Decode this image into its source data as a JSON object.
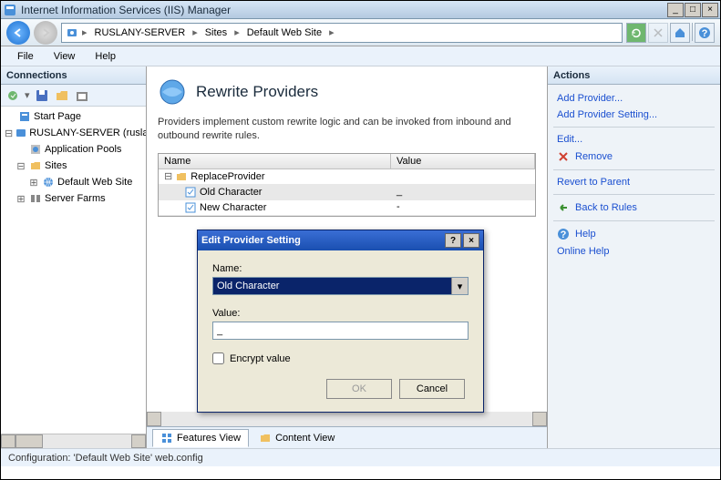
{
  "window": {
    "title": "Internet Information Services (IIS) Manager"
  },
  "breadcrumb": {
    "server": "RUSLANY-SERVER",
    "sites": "Sites",
    "site": "Default Web Site"
  },
  "menus": {
    "file": "File",
    "view": "View",
    "help": "Help"
  },
  "connections": {
    "header": "Connections",
    "start_page": "Start Page",
    "server": "RUSLANY-SERVER (ruslany)",
    "app_pools": "Application Pools",
    "sites": "Sites",
    "default_site": "Default Web Site",
    "server_farms": "Server Farms"
  },
  "page": {
    "title": "Rewrite Providers",
    "description": "Providers implement custom rewrite logic and can be invoked from inbound and outbound rewrite rules.",
    "columns": {
      "name": "Name",
      "value": "Value"
    },
    "rows": [
      {
        "name": "ReplaceProvider",
        "value": "",
        "type": "folder"
      },
      {
        "name": "Old Character",
        "value": "_",
        "type": "setting"
      },
      {
        "name": "New Character",
        "value": "-",
        "type": "setting"
      }
    ]
  },
  "tabs": {
    "features": "Features View",
    "content": "Content View"
  },
  "actions": {
    "header": "Actions",
    "add_provider": "Add Provider...",
    "add_setting": "Add Provider Setting...",
    "edit": "Edit...",
    "remove": "Remove",
    "revert": "Revert to Parent",
    "back": "Back to Rules",
    "help": "Help",
    "online_help": "Online Help"
  },
  "dialog": {
    "title": "Edit Provider Setting",
    "name_label": "Name:",
    "name_value": "Old Character",
    "value_label": "Value:",
    "value_value": "_",
    "encrypt_label": "Encrypt value",
    "ok": "OK",
    "cancel": "Cancel"
  },
  "status": {
    "text": "Configuration: 'Default Web Site' web.config"
  }
}
